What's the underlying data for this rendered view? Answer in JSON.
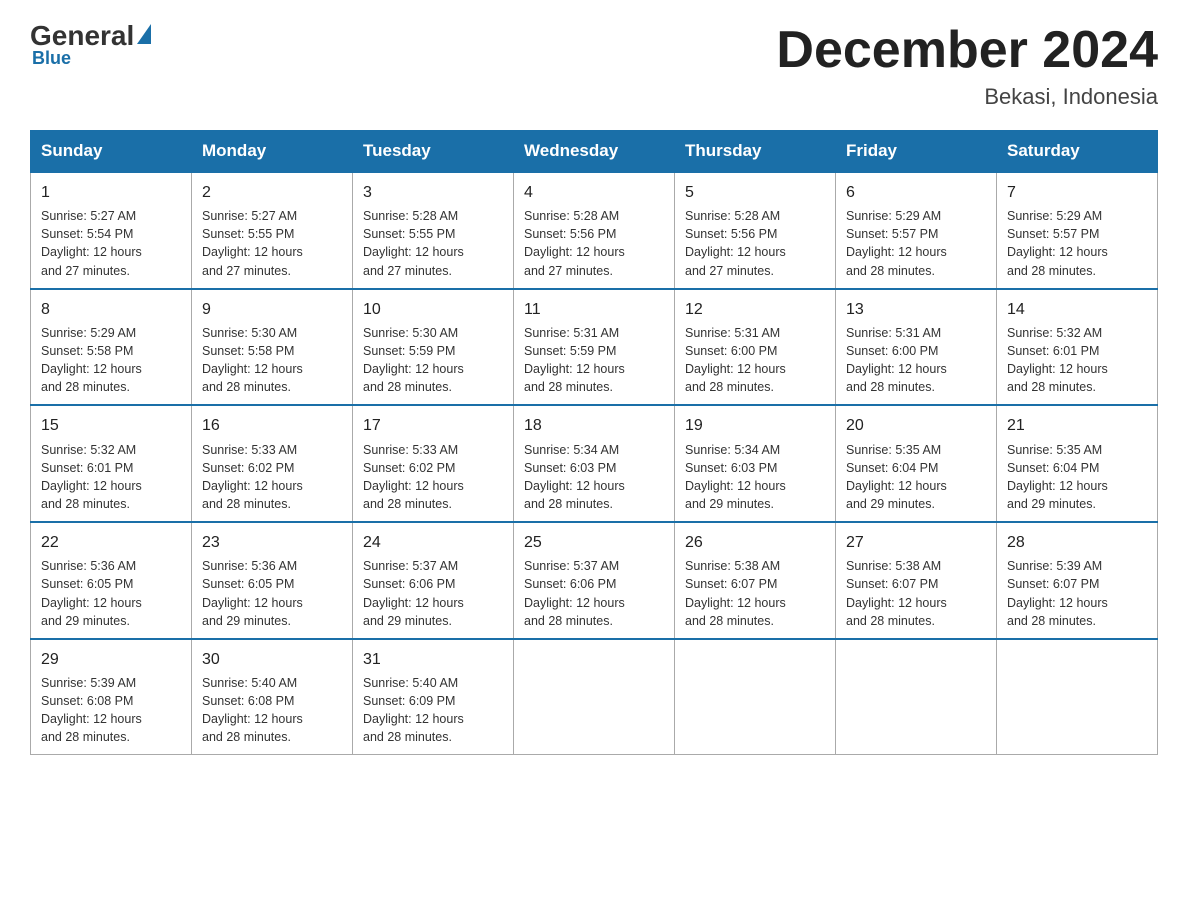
{
  "header": {
    "logo_general": "General",
    "logo_blue": "Blue",
    "main_title": "December 2024",
    "subtitle": "Bekasi, Indonesia"
  },
  "days_of_week": [
    "Sunday",
    "Monday",
    "Tuesday",
    "Wednesday",
    "Thursday",
    "Friday",
    "Saturday"
  ],
  "weeks": [
    [
      {
        "day": 1,
        "sunrise": "5:27 AM",
        "sunset": "5:54 PM",
        "daylight": "12 hours and 27 minutes."
      },
      {
        "day": 2,
        "sunrise": "5:27 AM",
        "sunset": "5:55 PM",
        "daylight": "12 hours and 27 minutes."
      },
      {
        "day": 3,
        "sunrise": "5:28 AM",
        "sunset": "5:55 PM",
        "daylight": "12 hours and 27 minutes."
      },
      {
        "day": 4,
        "sunrise": "5:28 AM",
        "sunset": "5:56 PM",
        "daylight": "12 hours and 27 minutes."
      },
      {
        "day": 5,
        "sunrise": "5:28 AM",
        "sunset": "5:56 PM",
        "daylight": "12 hours and 27 minutes."
      },
      {
        "day": 6,
        "sunrise": "5:29 AM",
        "sunset": "5:57 PM",
        "daylight": "12 hours and 28 minutes."
      },
      {
        "day": 7,
        "sunrise": "5:29 AM",
        "sunset": "5:57 PM",
        "daylight": "12 hours and 28 minutes."
      }
    ],
    [
      {
        "day": 8,
        "sunrise": "5:29 AM",
        "sunset": "5:58 PM",
        "daylight": "12 hours and 28 minutes."
      },
      {
        "day": 9,
        "sunrise": "5:30 AM",
        "sunset": "5:58 PM",
        "daylight": "12 hours and 28 minutes."
      },
      {
        "day": 10,
        "sunrise": "5:30 AM",
        "sunset": "5:59 PM",
        "daylight": "12 hours and 28 minutes."
      },
      {
        "day": 11,
        "sunrise": "5:31 AM",
        "sunset": "5:59 PM",
        "daylight": "12 hours and 28 minutes."
      },
      {
        "day": 12,
        "sunrise": "5:31 AM",
        "sunset": "6:00 PM",
        "daylight": "12 hours and 28 minutes."
      },
      {
        "day": 13,
        "sunrise": "5:31 AM",
        "sunset": "6:00 PM",
        "daylight": "12 hours and 28 minutes."
      },
      {
        "day": 14,
        "sunrise": "5:32 AM",
        "sunset": "6:01 PM",
        "daylight": "12 hours and 28 minutes."
      }
    ],
    [
      {
        "day": 15,
        "sunrise": "5:32 AM",
        "sunset": "6:01 PM",
        "daylight": "12 hours and 28 minutes."
      },
      {
        "day": 16,
        "sunrise": "5:33 AM",
        "sunset": "6:02 PM",
        "daylight": "12 hours and 28 minutes."
      },
      {
        "day": 17,
        "sunrise": "5:33 AM",
        "sunset": "6:02 PM",
        "daylight": "12 hours and 28 minutes."
      },
      {
        "day": 18,
        "sunrise": "5:34 AM",
        "sunset": "6:03 PM",
        "daylight": "12 hours and 28 minutes."
      },
      {
        "day": 19,
        "sunrise": "5:34 AM",
        "sunset": "6:03 PM",
        "daylight": "12 hours and 29 minutes."
      },
      {
        "day": 20,
        "sunrise": "5:35 AM",
        "sunset": "6:04 PM",
        "daylight": "12 hours and 29 minutes."
      },
      {
        "day": 21,
        "sunrise": "5:35 AM",
        "sunset": "6:04 PM",
        "daylight": "12 hours and 29 minutes."
      }
    ],
    [
      {
        "day": 22,
        "sunrise": "5:36 AM",
        "sunset": "6:05 PM",
        "daylight": "12 hours and 29 minutes."
      },
      {
        "day": 23,
        "sunrise": "5:36 AM",
        "sunset": "6:05 PM",
        "daylight": "12 hours and 29 minutes."
      },
      {
        "day": 24,
        "sunrise": "5:37 AM",
        "sunset": "6:06 PM",
        "daylight": "12 hours and 29 minutes."
      },
      {
        "day": 25,
        "sunrise": "5:37 AM",
        "sunset": "6:06 PM",
        "daylight": "12 hours and 28 minutes."
      },
      {
        "day": 26,
        "sunrise": "5:38 AM",
        "sunset": "6:07 PM",
        "daylight": "12 hours and 28 minutes."
      },
      {
        "day": 27,
        "sunrise": "5:38 AM",
        "sunset": "6:07 PM",
        "daylight": "12 hours and 28 minutes."
      },
      {
        "day": 28,
        "sunrise": "5:39 AM",
        "sunset": "6:07 PM",
        "daylight": "12 hours and 28 minutes."
      }
    ],
    [
      {
        "day": 29,
        "sunrise": "5:39 AM",
        "sunset": "6:08 PM",
        "daylight": "12 hours and 28 minutes."
      },
      {
        "day": 30,
        "sunrise": "5:40 AM",
        "sunset": "6:08 PM",
        "daylight": "12 hours and 28 minutes."
      },
      {
        "day": 31,
        "sunrise": "5:40 AM",
        "sunset": "6:09 PM",
        "daylight": "12 hours and 28 minutes."
      },
      null,
      null,
      null,
      null
    ]
  ],
  "labels": {
    "sunrise": "Sunrise:",
    "sunset": "Sunset:",
    "daylight": "Daylight:"
  }
}
